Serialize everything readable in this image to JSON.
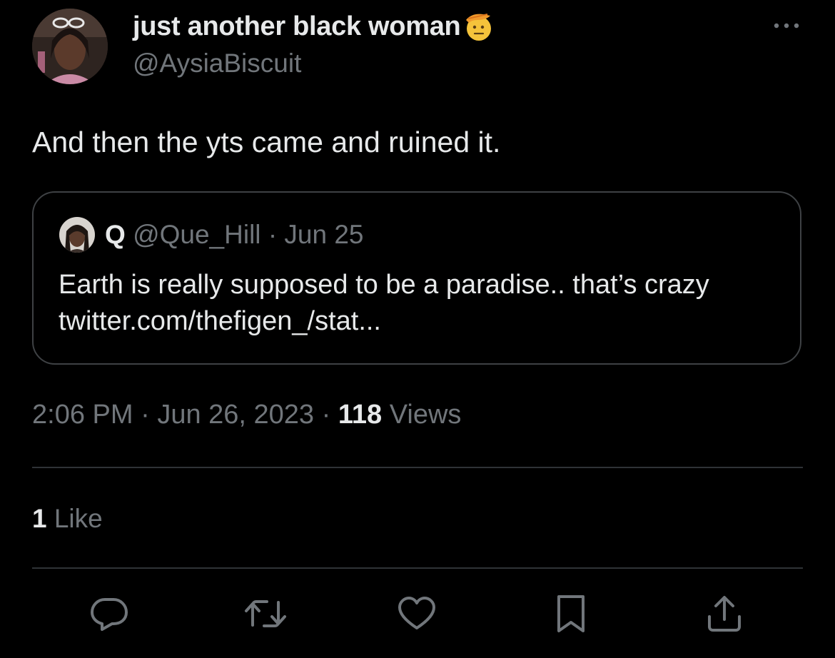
{
  "author": {
    "display_name": "just another black woman",
    "handle": "@AysiaBiscuit",
    "name_emoji": "saluting-face-emoji"
  },
  "tweet": {
    "text": "And then the yts came and ruined it."
  },
  "quoted_tweet": {
    "name": "Q",
    "handle": "@Que_Hill",
    "separator": "·",
    "date": "Jun 25",
    "text": "Earth is really supposed to be a paradise.. that’s crazy twitter.com/thefigen_/stat..."
  },
  "meta": {
    "time": "2:06 PM",
    "separator": "·",
    "date": "Jun 26, 2023",
    "separator2": "·",
    "views_count": "118",
    "views_label": "Views"
  },
  "engagement": {
    "like_count": "1",
    "like_label": "Like"
  },
  "actions": [
    {
      "icon": "reply-icon"
    },
    {
      "icon": "retweet-icon"
    },
    {
      "icon": "like-icon"
    },
    {
      "icon": "bookmark-icon"
    },
    {
      "icon": "share-icon"
    }
  ],
  "colors": {
    "background": "#000000",
    "primary_text": "#e7e9ea",
    "secondary_text": "#71767b",
    "border": "#2f3336"
  }
}
